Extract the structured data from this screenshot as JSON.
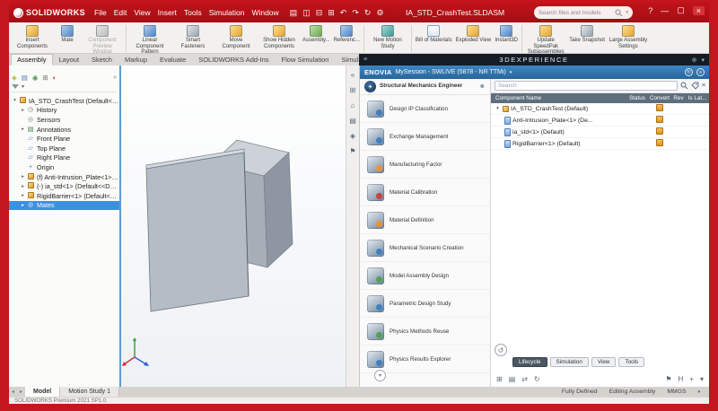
{
  "titlebar": {
    "logo_text": "SOLIDWORKS",
    "menus": [
      "File",
      "Edit",
      "View",
      "Insert",
      "Tools",
      "Simulation",
      "Window"
    ],
    "document_title": "IA_STD_CrashTest.SLDASM",
    "search_placeholder": "Search files and models"
  },
  "ribbon": {
    "buttons": [
      "Insert Components",
      "Mate",
      "Component Preview Window",
      "Linear Component Pattern",
      "Smart Fasteners",
      "Move Component",
      "Show Hidden Components",
      "Assembly...",
      "Referenc...",
      "New Motion Study",
      "Bill of Materials",
      "Exploded View",
      "Instant3D",
      "Update SpeedPak Subassemblies",
      "Take Snapshot",
      "Large Assembly Settings"
    ]
  },
  "command_tabs": [
    "Assembly",
    "Layout",
    "Sketch",
    "Markup",
    "Evaluate",
    "SOLIDWORKS Add-Ins",
    "Flow Simulation",
    "Simulation"
  ],
  "dx_header": {
    "title": "3DEXPERIENCE"
  },
  "feature_tree": [
    "IA_STD_CrashTest (Default<Display",
    "History",
    "Sensors",
    "Annotations",
    "Front Plane",
    "Top Plane",
    "Right Plane",
    "Origin",
    "(f) Anti-Intrusion_Plate<1> (Defaul...",
    "(-) ia_std<1> (Default<<Default>...",
    "RigidBarrier<1> (Default<<Defaul...",
    "Mates"
  ],
  "sme": {
    "title": "Structural Mechanics Engineer",
    "apps": [
      "Design IP Classification",
      "Exchange Management",
      "Manufacturing Factor",
      "Material Calibration",
      "Material Definition",
      "Mechanical Scenario Creation",
      "Model Assembly Design",
      "Parametric Design Study",
      "Physics Methods Reuse",
      "Physics Results Explorer"
    ]
  },
  "enovia": {
    "brand": "ENOVIA",
    "session": "MySession - SWLIVE (5878 - NR TTMi)",
    "search_placeholder": "Search",
    "columns": [
      "Component Name",
      "Status",
      "Convert",
      "Rev",
      "Is Lat..."
    ],
    "rows": [
      "IA_STD_CrashTest (Default)",
      "Anti-Intrusion_Plate<1> (De...",
      "ia_std<1> (Default)",
      "RigidBarrier<1> (Default)"
    ],
    "bottom_tabs": [
      "Lifecycle",
      "Simulation",
      "View",
      "Tools"
    ]
  },
  "statusbar": {
    "model_tabs": [
      "Model",
      "Motion Study 1"
    ],
    "left_text": "SOLIDWORKS Premium 2021 SP1.0",
    "right_items": [
      "Fully Defined",
      "Editing Assembly",
      "MMGS"
    ]
  }
}
